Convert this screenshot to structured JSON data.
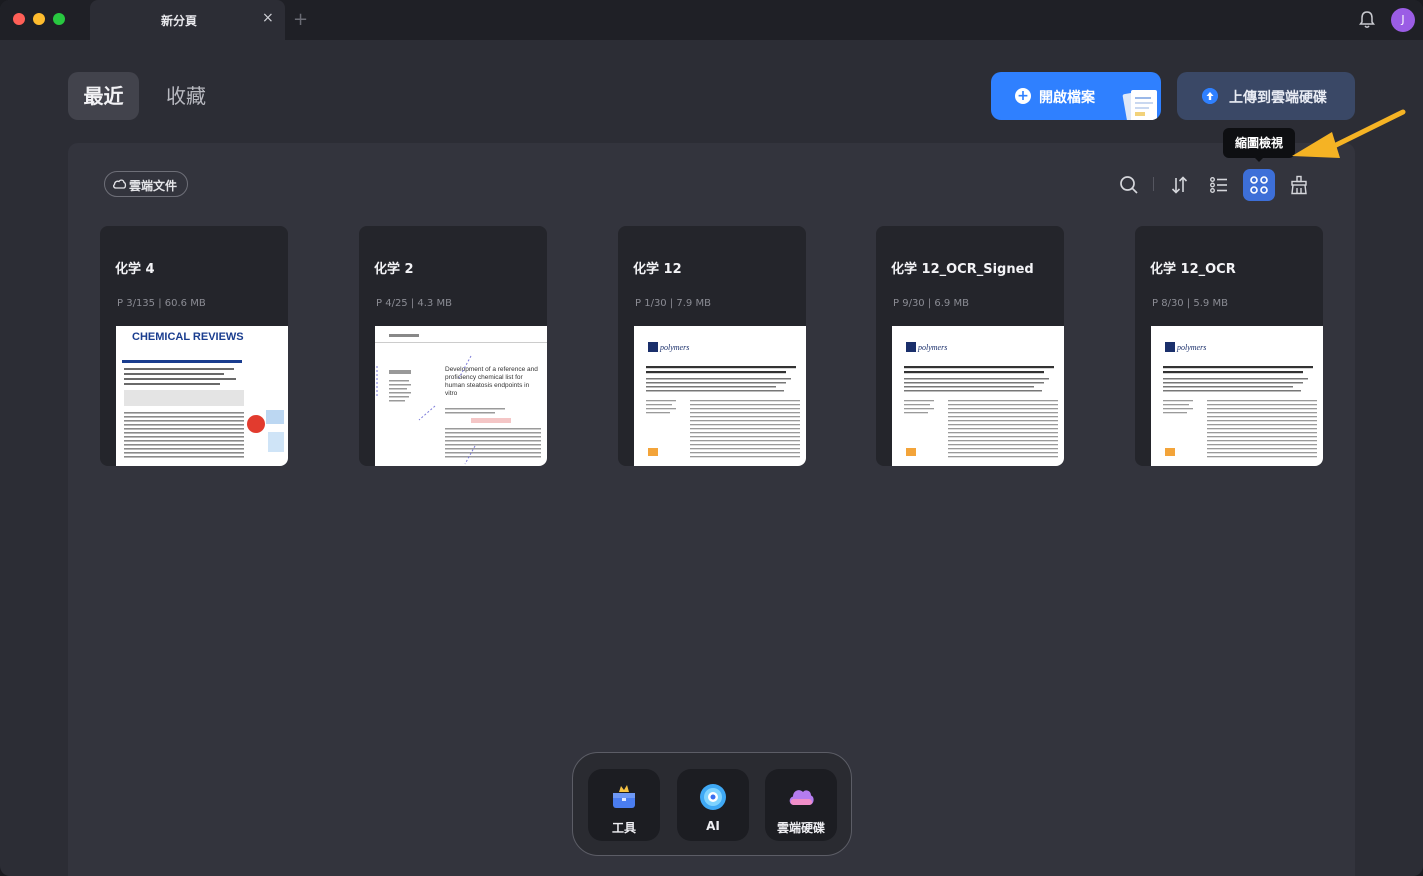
{
  "titlebar": {
    "tab_title": "新分頁",
    "close_glyph": "×",
    "new_tab_glyph": "+",
    "avatar_initial": "J"
  },
  "nav": {
    "recent_label": "最近",
    "favorites_label": "收藏",
    "open_file_label": "開啟檔案",
    "upload_label": "上傳到雲端硬碟"
  },
  "toolbar": {
    "cloud_docs_label": "雲端文件",
    "tooltip": "縮圖檢視",
    "icons": [
      "search-icon",
      "sort-icon",
      "list-view-icon",
      "grid-view-icon",
      "clear-recent-icon"
    ],
    "active_view": "grid"
  },
  "files": [
    {
      "name": "化学 4",
      "meta": "P 3/135  |  60.6 MB",
      "thumb_title": "CHEMICAL REVIEWS"
    },
    {
      "name": "化学 2",
      "meta": "P 4/25  |  4.3 MB",
      "thumb_title": "Development of a reference and proficiency chemical list for human steatosis endpoints in vitro"
    },
    {
      "name": "化学 12",
      "meta": "P 1/30  |  7.9 MB",
      "thumb_title": "polymers"
    },
    {
      "name": "化学 12_OCR_Signed",
      "meta": "P 9/30  |  6.9 MB",
      "thumb_title": "polymers"
    },
    {
      "name": "化学 12_OCR",
      "meta": "P 8/30  |  5.9 MB",
      "thumb_title": "polymers"
    }
  ],
  "dock": {
    "tools_label": "工具",
    "ai_label": "AI",
    "cloud_label": "雲端硬碟"
  },
  "colors": {
    "accent": "#2f80ff",
    "callout_arrow": "#f5b324"
  }
}
